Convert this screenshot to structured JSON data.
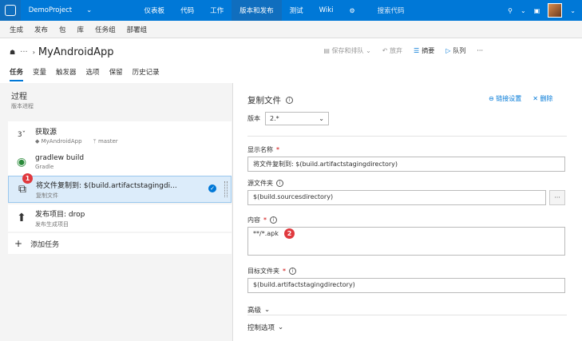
{
  "topbar": {
    "project": "DemoProject",
    "nav": [
      "仪表板",
      "代码",
      "工作",
      "版本和发布",
      "测试",
      "Wiki"
    ],
    "active_nav": 3,
    "search_placeholder": "搜索代码"
  },
  "subnav": [
    "生成",
    "发布",
    "包",
    "库",
    "任务组",
    "部署组"
  ],
  "header": {
    "title": "MyAndroidApp",
    "actions": {
      "save": "保存和排队",
      "undo": "放弃",
      "summary": "摘要",
      "queue": "队列"
    }
  },
  "tabs": [
    "任务",
    "变量",
    "触发器",
    "选项",
    "保留",
    "历史记录"
  ],
  "process": {
    "title": "过程",
    "subtitle": "版本进程"
  },
  "tasks": [
    {
      "name": "获取源",
      "sub": "MyAndroidApp",
      "branch": "master"
    },
    {
      "name": "gradlew build",
      "sub": "Gradle"
    },
    {
      "name": "将文件复制到: $(build.artifactstagingdi...",
      "sub": "复制文件"
    },
    {
      "name": "发布项目: drop",
      "sub": "发布生成项目"
    }
  ],
  "add_task": "添加任务",
  "badges": {
    "one": "1",
    "two": "2"
  },
  "detail": {
    "title": "复制文件",
    "link_settings": "链接设置",
    "delete": "删除",
    "version_label": "版本",
    "version_value": "2.*",
    "display_name_label": "显示名称",
    "display_name_value": "将文件复制到: $(build.artifactstagingdirectory)",
    "source_label": "源文件夹",
    "source_value": "$(build.sourcesdirectory)",
    "contents_label": "内容",
    "contents_value": "**/*.apk",
    "target_label": "目标文件夹",
    "target_value": "$(build.artifactstagingdirectory)",
    "advanced": "高级",
    "control_options": "控制选项"
  }
}
